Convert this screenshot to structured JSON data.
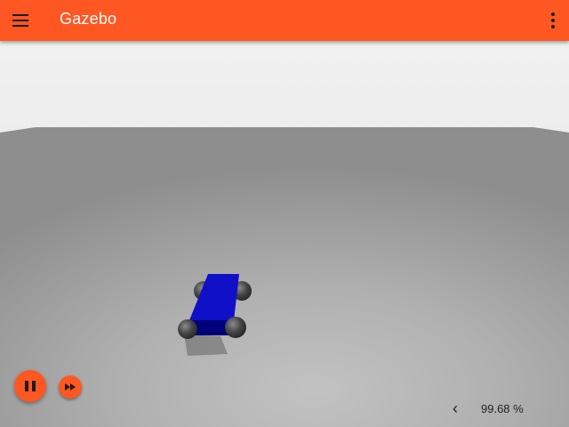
{
  "header": {
    "title": "Gazebo",
    "menu_icon": "hamburger-menu-icon",
    "more_icon": "more-vert-icon"
  },
  "controls": {
    "pause_icon": "pause-icon",
    "step_icon": "fast-forward-icon",
    "rtf_toggle_icon": "chevron-left-icon",
    "rtf_toggle_glyph": "‹",
    "real_time_factor": "99.68 %"
  },
  "colors": {
    "accent": "#ff5722",
    "robot_body": "#0a0ab0",
    "wheels": "#3c3c3c",
    "ground": "#a7a7a7",
    "sky": "#e6e6e6"
  }
}
